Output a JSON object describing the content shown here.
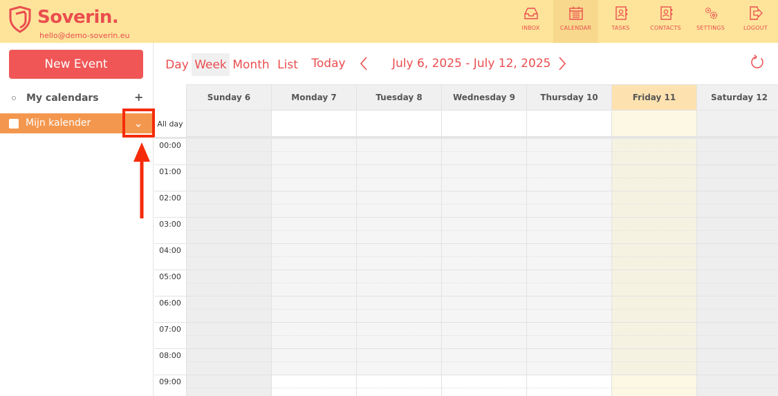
{
  "brand": {
    "name": "Soverin.",
    "email": "hello@demo-soverin.eu"
  },
  "colors": {
    "accent": "#ea4d4f",
    "header_bg": "#fde49a",
    "calendar_row": "#f4974e",
    "today_bg": "#fde2b0"
  },
  "nav": [
    {
      "label": "INBOX",
      "icon": "inbox-icon",
      "active": false
    },
    {
      "label": "CALENDAR",
      "icon": "calendar-icon",
      "active": true
    },
    {
      "label": "TASKS",
      "icon": "tasks-icon",
      "active": false
    },
    {
      "label": "CONTACTS",
      "icon": "contacts-icon",
      "active": false
    },
    {
      "label": "SETTINGS",
      "icon": "settings-icon",
      "active": false
    },
    {
      "label": "LOGOUT",
      "icon": "logout-icon",
      "active": false
    }
  ],
  "sidebar": {
    "new_event_label": "New Event",
    "calendars_title": "My calendars",
    "add_label": "+",
    "calendars": [
      {
        "name": "Mijn kalender",
        "checked": false
      }
    ]
  },
  "toolbar": {
    "views": [
      "Day",
      "Week",
      "Month",
      "List"
    ],
    "active_view": "Week",
    "today_label": "Today",
    "range": "July 6, 2025 - July 12, 2025"
  },
  "week": {
    "days": [
      "Sunday 6",
      "Monday 7",
      "Tuesday 8",
      "Wednesday 9",
      "Thursday 10",
      "Friday 11",
      "Saturday 12"
    ],
    "today_index": 5,
    "allday_label": "All day",
    "hours": [
      "00:00",
      "01:00",
      "02:00",
      "03:00",
      "04:00",
      "05:00",
      "06:00",
      "07:00",
      "08:00",
      "09:00"
    ],
    "business_start_hour": 9
  }
}
